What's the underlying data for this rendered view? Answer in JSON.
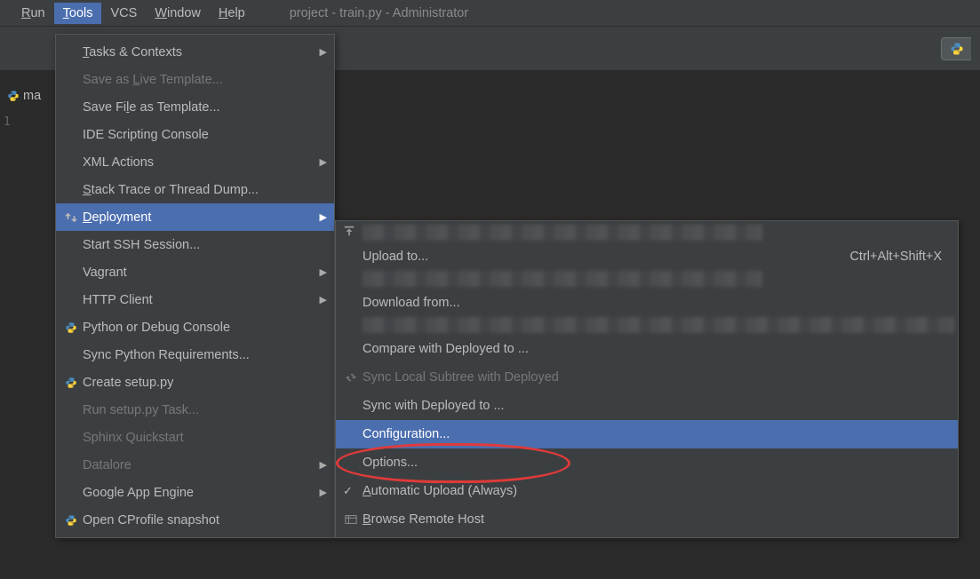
{
  "menubar": {
    "items": [
      "Run",
      "Tools",
      "VCS",
      "Window",
      "Help"
    ],
    "underline": [
      "R",
      "T",
      "",
      "W",
      "H"
    ],
    "active_index": 1,
    "window_title": "project - train.py - Administrator"
  },
  "file_tab": "ma",
  "line_number": "1",
  "tools_menu": [
    {
      "label": "Tasks & Contexts",
      "u": "T",
      "submenu": true
    },
    {
      "label": "Save as Live Template...",
      "u": "L",
      "disabled": true
    },
    {
      "label": "Save File as Template...",
      "u": "l"
    },
    {
      "label": "IDE Scripting Console"
    },
    {
      "label": "XML Actions",
      "submenu": true
    },
    {
      "label": "Stack Trace or Thread Dump...",
      "u": "S"
    },
    {
      "label": "Deployment",
      "u": "D",
      "submenu": true,
      "selected": true,
      "icon": "deploy"
    },
    {
      "label": "Start SSH Session..."
    },
    {
      "label": "Vagrant",
      "submenu": true
    },
    {
      "label": "HTTP Client",
      "submenu": true
    },
    {
      "label": "Python or Debug Console",
      "icon": "python"
    },
    {
      "label": "Sync Python Requirements..."
    },
    {
      "label": "Create setup.py",
      "icon": "python"
    },
    {
      "label": "Run setup.py Task...",
      "disabled": true
    },
    {
      "label": "Sphinx Quickstart",
      "disabled": true
    },
    {
      "label": "Datalore",
      "disabled": true,
      "submenu": true
    },
    {
      "label": "Google App Engine",
      "submenu": true
    },
    {
      "label": "Open CProfile snapshot",
      "icon": "snapshot"
    }
  ],
  "deployment_menu": [
    {
      "type": "pixel",
      "variant": "short",
      "icon": "upload-top"
    },
    {
      "label": "Upload to...",
      "shortcut": "Ctrl+Alt+Shift+X"
    },
    {
      "type": "pixel",
      "variant": "short"
    },
    {
      "label": "Download from..."
    },
    {
      "type": "pixel",
      "variant": "full"
    },
    {
      "label": "Compare with Deployed to ..."
    },
    {
      "label": "Sync Local Subtree with Deployed",
      "disabled": true,
      "icon": "sync"
    },
    {
      "label": "Sync with Deployed to ..."
    },
    {
      "label": "Configuration...",
      "selected": true
    },
    {
      "label": "Options..."
    },
    {
      "label": "Automatic Upload (Always)",
      "u": "A",
      "check": true
    },
    {
      "label": "Browse Remote Host",
      "u": "B",
      "icon": "browse"
    }
  ]
}
